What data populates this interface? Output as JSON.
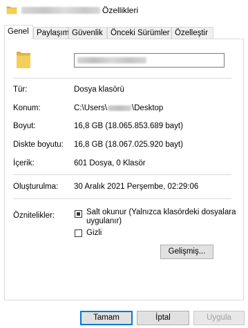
{
  "window": {
    "title_suffix": "Özellikleri",
    "folder_icon": "folder-icon"
  },
  "tabs": [
    {
      "label": "Genel",
      "active": true
    },
    {
      "label": "Paylaşım",
      "active": false
    },
    {
      "label": "Güvenlik",
      "active": false
    },
    {
      "label": "Önceki Sürümler",
      "active": false
    },
    {
      "label": "Özelleştir",
      "active": false
    }
  ],
  "general": {
    "name_value": "",
    "type_label": "Tür:",
    "type_value": "Dosya klasörü",
    "location_label": "Konum:",
    "location_prefix": "C:\\Users\\",
    "location_suffix": "\\Desktop",
    "size_label": "Boyut:",
    "size_value": "16,8 GB (18.065.853.689 bayt)",
    "disk_size_label": "Diskte boyutu:",
    "disk_size_value": "16,8 GB (18.067.025.920 bayt)",
    "contents_label": "İçerik:",
    "contents_value": "601 Dosya, 0 Klasör",
    "created_label": "Oluşturulma:",
    "created_value": "30 Aralık 2021 Perşembe, 02:29:06",
    "attributes_label": "Öznitelikler:",
    "readonly_line1": "Salt okunur (Yalnızca klasördeki dosyalara",
    "readonly_line2": "uygulanır)",
    "readonly_state": "indeterminate",
    "hidden_label": "Gizli",
    "hidden_checked": false,
    "advanced_button": "Gelişmiş..."
  },
  "footer": {
    "ok": "Tamam",
    "cancel": "İptal",
    "apply": "Uygula"
  },
  "colors": {
    "folder": "#f2c84b",
    "accent": "#0078d7",
    "border": "#d9d9d9"
  }
}
